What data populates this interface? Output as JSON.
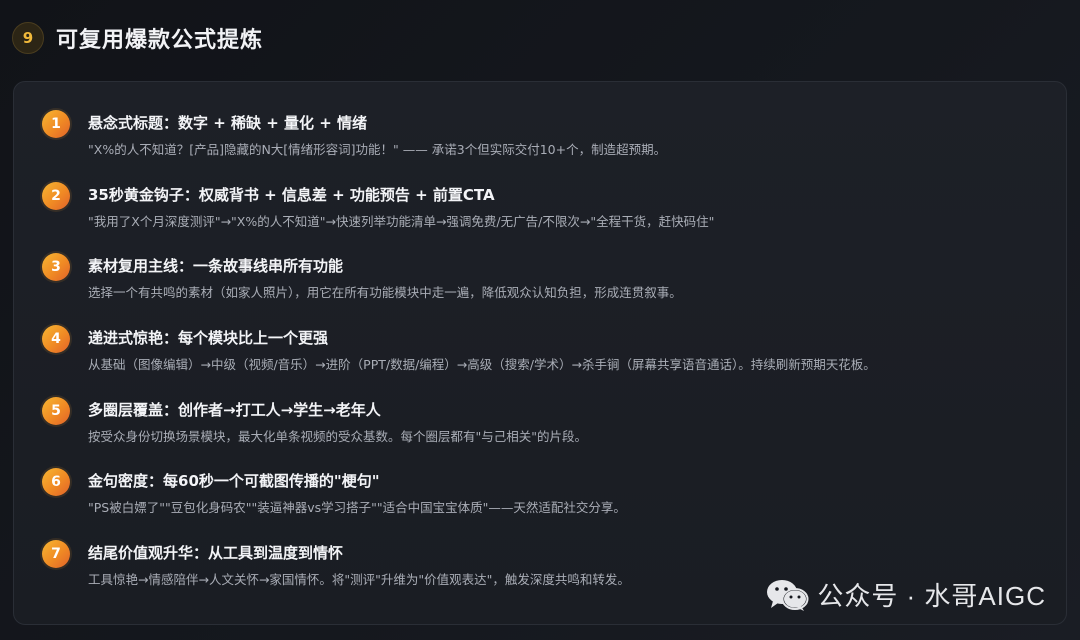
{
  "header": {
    "badge": "9",
    "title": "可复用爆款公式提炼"
  },
  "items": [
    {
      "num": "1",
      "title": "悬念式标题：数字 + 稀缺 + 量化 + 情绪",
      "desc": "\"X%的人不知道？[产品]隐藏的N大[情绪形容词]功能！\" —— 承诺3个但实际交付10+个，制造超预期。"
    },
    {
      "num": "2",
      "title": "35秒黄金钩子：权威背书 + 信息差 + 功能预告 + 前置CTA",
      "desc": "\"我用了X个月深度测评\"→\"X%的人不知道\"→快速列举功能清单→强调免费/无广告/不限次→\"全程干货，赶快码住\""
    },
    {
      "num": "3",
      "title": "素材复用主线：一条故事线串所有功能",
      "desc": "选择一个有共鸣的素材（如家人照片），用它在所有功能模块中走一遍，降低观众认知负担，形成连贯叙事。"
    },
    {
      "num": "4",
      "title": "递进式惊艳：每个模块比上一个更强",
      "desc": "从基础（图像编辑）→中级（视频/音乐）→进阶（PPT/数据/编程）→高级（搜索/学术）→杀手锏（屏幕共享语音通话）。持续刷新预期天花板。"
    },
    {
      "num": "5",
      "title": "多圈层覆盖：创作者→打工人→学生→老年人",
      "desc": "按受众身份切换场景模块，最大化单条视频的受众基数。每个圈层都有\"与己相关\"的片段。"
    },
    {
      "num": "6",
      "title": "金句密度：每60秒一个可截图传播的\"梗句\"",
      "desc": "\"PS被白嫖了\"\"豆包化身码农\"\"装逼神器vs学习搭子\"\"适合中国宝宝体质\"——天然适配社交分享。"
    },
    {
      "num": "7",
      "title": "结尾价值观升华：从工具到温度到情怀",
      "desc": "工具惊艳→情感陪伴→人文关怀→家国情怀。将\"测评\"升维为\"价值观表达\"，触发深度共鸣和转发。"
    }
  ],
  "watermark": {
    "text": "公众号 · 水哥AIGC",
    "icon": "wechat-icon"
  }
}
